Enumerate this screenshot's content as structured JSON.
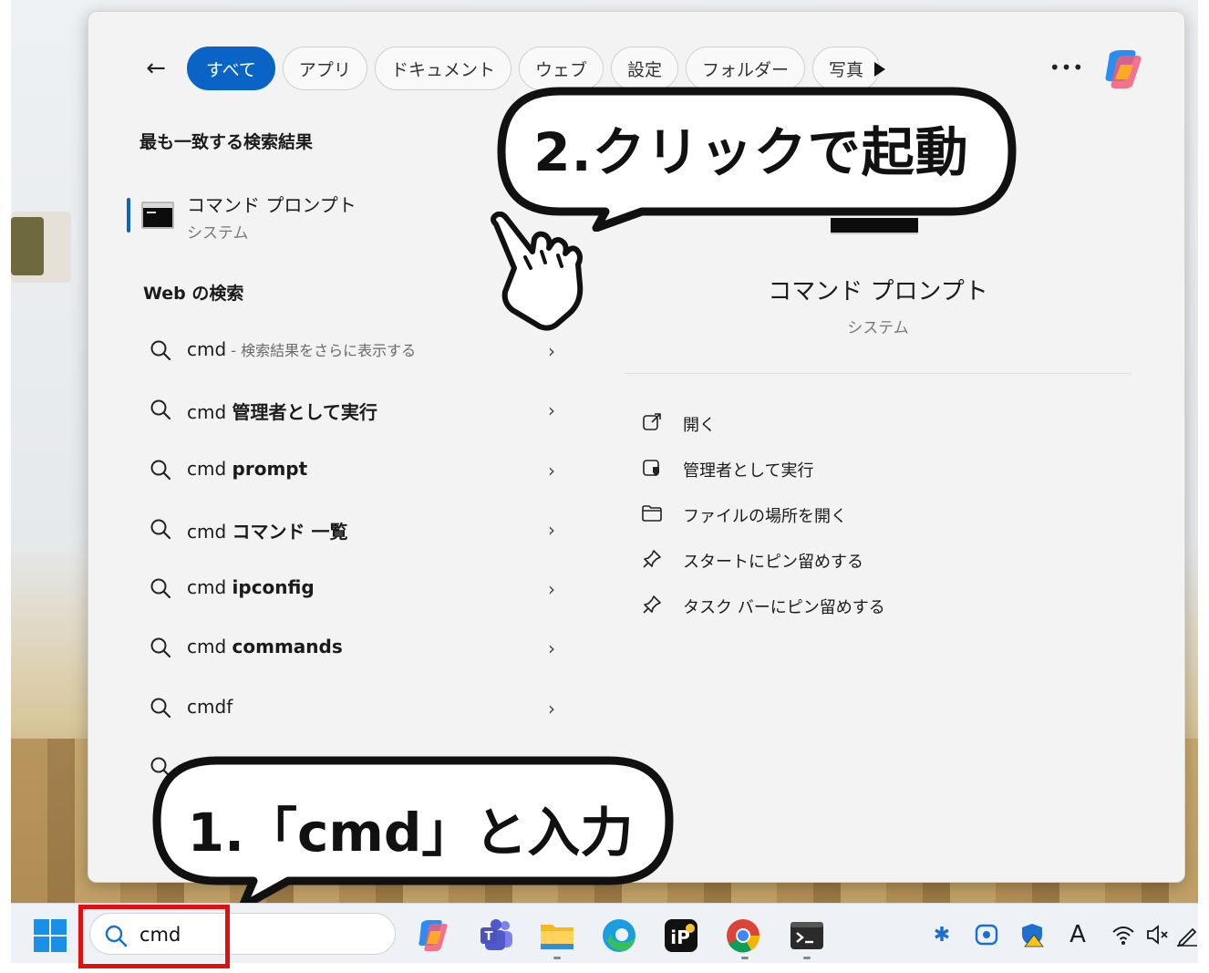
{
  "tabs": [
    "すべて",
    "アプリ",
    "ドキュメント",
    "ウェブ",
    "設定",
    "フォルダー",
    "写真"
  ],
  "best_match": {
    "heading": "最も一致する検索結果",
    "name": "コマンド プロンプト",
    "subtitle": "システム"
  },
  "web_search": {
    "heading": "Web の検索",
    "items": [
      {
        "prefix": "cmd",
        "bold": "",
        "hint": " - 検索結果をさらに表示する"
      },
      {
        "prefix": "cmd ",
        "bold": "管理者として実行",
        "hint": ""
      },
      {
        "prefix": "cmd ",
        "bold": "prompt",
        "hint": ""
      },
      {
        "prefix": "cmd ",
        "bold": "コマンド 一覧",
        "hint": ""
      },
      {
        "prefix": "cmd ",
        "bold": "ipconfig",
        "hint": ""
      },
      {
        "prefix": "cmd ",
        "bold": "commands",
        "hint": ""
      },
      {
        "prefix": "cmd",
        "bold": "f",
        "hint": ""
      }
    ]
  },
  "detail": {
    "title": "コマンド プロンプト",
    "subtitle": "システム",
    "actions": [
      {
        "label": "開く",
        "icon": "open-external-icon"
      },
      {
        "label": "管理者として実行",
        "icon": "admin-shield-icon"
      },
      {
        "label": "ファイルの場所を開く",
        "icon": "folder-icon"
      },
      {
        "label": "スタートにピン留めする",
        "icon": "pin-icon"
      },
      {
        "label": "タスク バーにピン留めする",
        "icon": "pin-icon"
      }
    ]
  },
  "callouts": {
    "step1": "1.「cmd」と入力",
    "step2": "2.クリックで起動"
  },
  "taskbar": {
    "search_value": "cmd",
    "apps": [
      "copilot",
      "teams",
      "file-explorer",
      "edge",
      "ibis-paint",
      "chrome",
      "terminal"
    ],
    "tray": [
      "bluetooth",
      "meet-now",
      "security-warning",
      "ime-a",
      "wifi",
      "volume-muted",
      "pen"
    ]
  },
  "colors": {
    "accent": "#0a64c5",
    "highlight_border": "#e01010"
  }
}
